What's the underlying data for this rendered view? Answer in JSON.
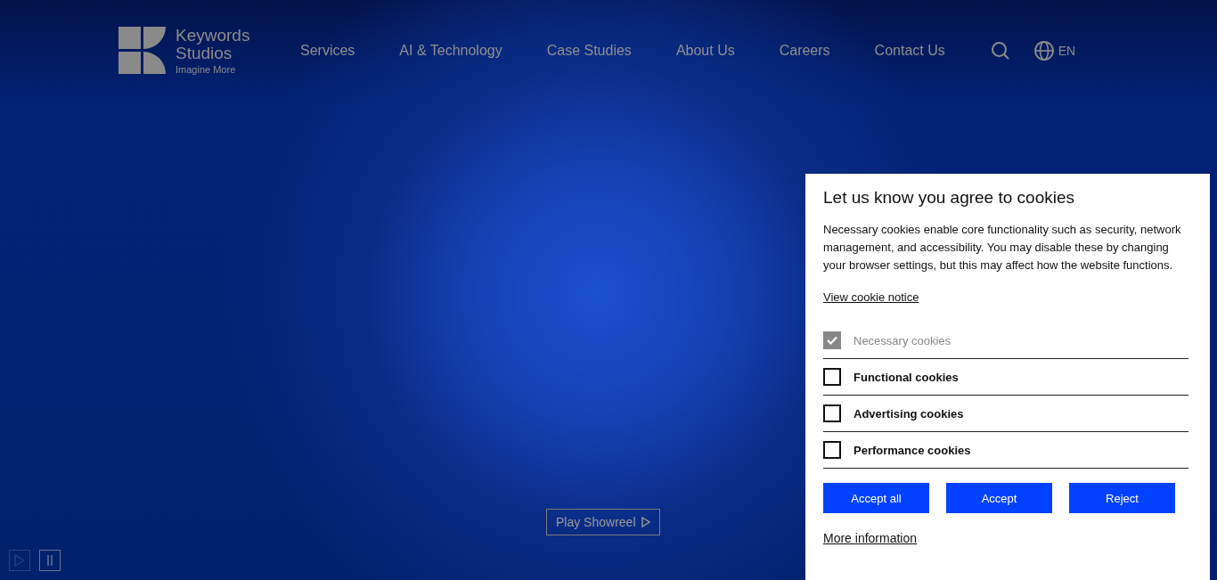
{
  "header": {
    "logo": {
      "name": "Keywords Studios",
      "tagline": "Imagine More"
    },
    "nav": [
      {
        "label": "Services"
      },
      {
        "label": "AI & Technology"
      },
      {
        "label": "Case Studies"
      },
      {
        "label": "About Us"
      },
      {
        "label": "Careers"
      },
      {
        "label": "Contact Us"
      }
    ],
    "language": "EN"
  },
  "hero": {
    "showreel_button": "Play Showreel",
    "video_controls": [
      {
        "kind": "play",
        "disabled": true
      },
      {
        "kind": "pause",
        "disabled": false
      }
    ]
  },
  "cookie_dialog": {
    "title": "Let us know you agree to cookies",
    "body": "Necessary cookies enable core functionality such as security, network management, and accessibility. You may disable these by changing your browser settings, but this may affect how the website functions.",
    "notice_link": "View cookie notice",
    "options": [
      {
        "label": "Necessary cookies",
        "checked": true,
        "disabled": true
      },
      {
        "label": "Functional cookies",
        "checked": false,
        "disabled": false
      },
      {
        "label": "Advertising cookies",
        "checked": false,
        "disabled": false
      },
      {
        "label": "Performance cookies",
        "checked": false,
        "disabled": false
      }
    ],
    "buttons": [
      "Accept all",
      "Accept",
      "Reject"
    ],
    "more_link": "More information"
  }
}
